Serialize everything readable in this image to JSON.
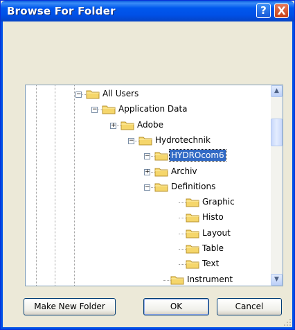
{
  "window": {
    "title": "Browse For Folder"
  },
  "titlebar": {
    "help_glyph": "?",
    "close_glyph": "X"
  },
  "tree": {
    "items": [
      {
        "label": "All Users",
        "expander": "−",
        "selected": false
      },
      {
        "label": "Application Data",
        "expander": "−",
        "selected": false
      },
      {
        "label": "Adobe",
        "expander": "+",
        "selected": false
      },
      {
        "label": "Hydrotechnik",
        "expander": "−",
        "selected": false
      },
      {
        "label": "HYDROcom6",
        "expander": "−",
        "selected": true
      },
      {
        "label": "Archiv",
        "expander": "+",
        "selected": false
      },
      {
        "label": "Definitions",
        "expander": "−",
        "selected": false
      },
      {
        "label": "Graphic",
        "expander": "",
        "selected": false
      },
      {
        "label": "Histo",
        "expander": "",
        "selected": false
      },
      {
        "label": "Layout",
        "expander": "",
        "selected": false
      },
      {
        "label": "Table",
        "expander": "",
        "selected": false
      },
      {
        "label": "Text",
        "expander": "",
        "selected": false
      },
      {
        "label": "Instrument",
        "expander": "",
        "selected": false
      }
    ]
  },
  "scrollbar": {
    "up_glyph": "▲",
    "down_glyph": "▼"
  },
  "buttons": {
    "new_folder": "Make New Folder",
    "ok": "OK",
    "cancel": "Cancel"
  },
  "colors": {
    "titlebar": "#0058ee",
    "selection": "#316ac5",
    "folder": "#f5d66b"
  }
}
